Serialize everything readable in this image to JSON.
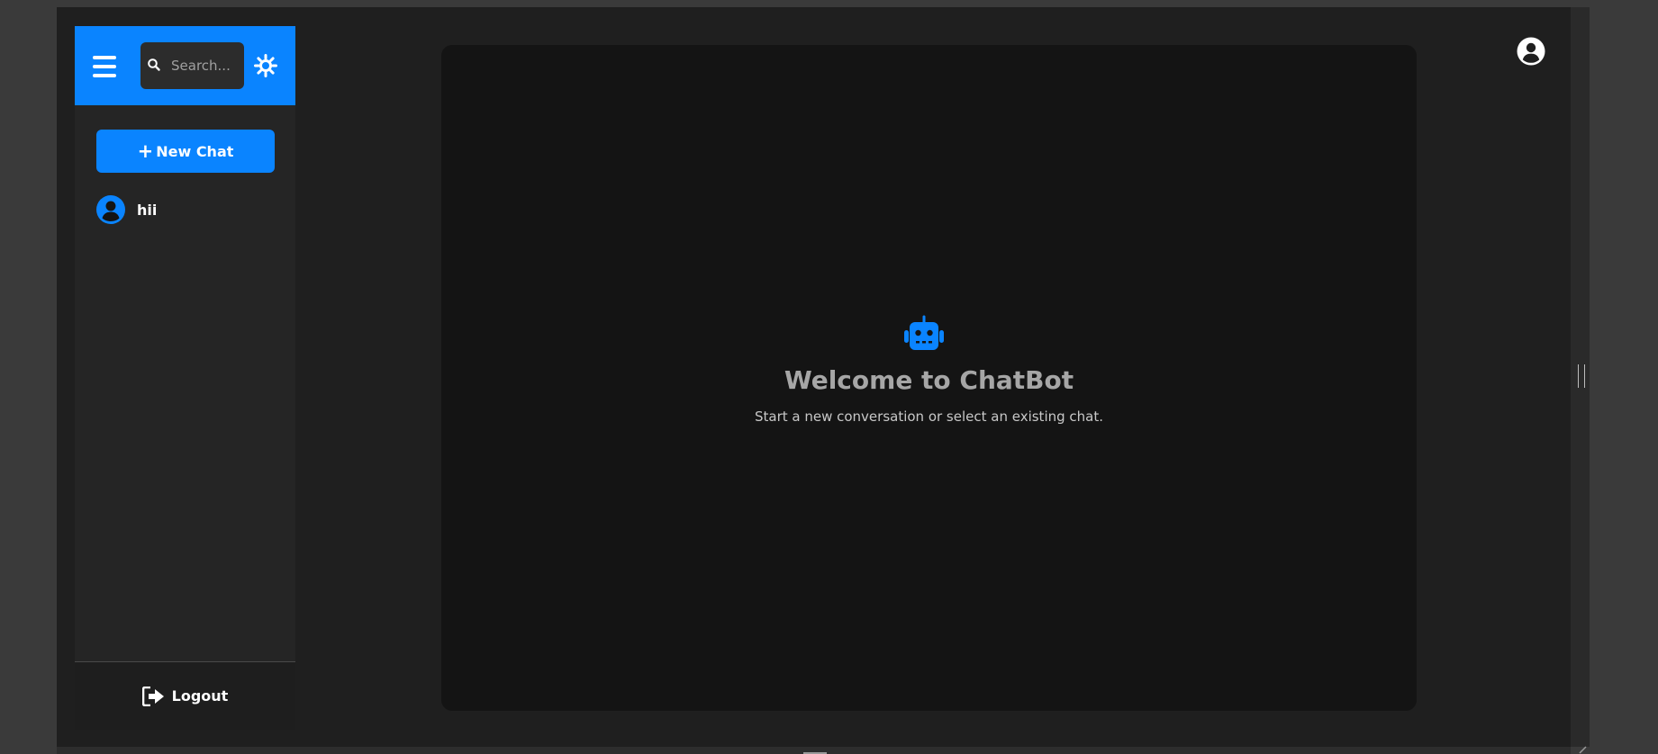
{
  "sidebar": {
    "search": {
      "placeholder": "Search..."
    },
    "new_chat_label": "New Chat",
    "chats": [
      {
        "label": "hii"
      }
    ],
    "logout_label": "Logout"
  },
  "main": {
    "welcome_title": "Welcome to ChatBot",
    "welcome_subtitle": "Start a new conversation or select an existing chat."
  },
  "icons": {
    "menu": "hamburger-menu-icon",
    "search": "search-icon",
    "theme": "sun-icon",
    "new_chat": "plus-icon",
    "chat_avatar": "user-circle-icon",
    "logout": "sign-out-icon",
    "welcome": "robot-icon",
    "profile": "user-circle-icon"
  },
  "colors": {
    "accent": "#0a84ff",
    "app_background": "#1f1f1f",
    "sidebar_background": "#252525",
    "panel_background": "#141414",
    "title_text": "#a6a6a6"
  }
}
